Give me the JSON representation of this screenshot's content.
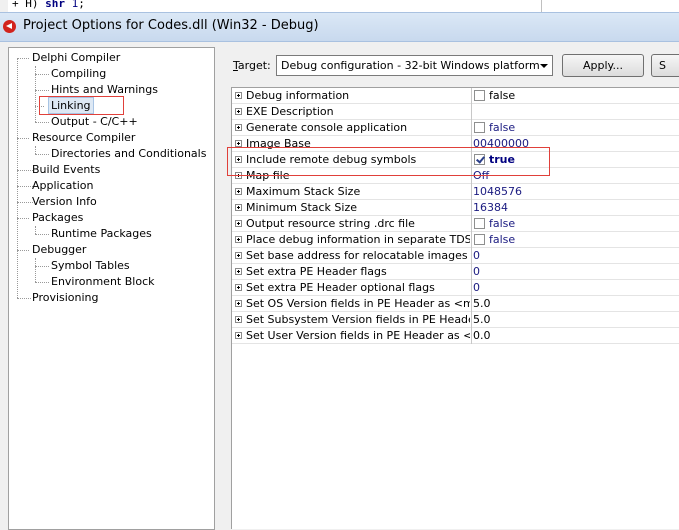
{
  "window": {
    "title": "Project Options for Codes.dll  (Win32 - Debug)"
  },
  "code_fragment": {
    "prefix": "+ H)  ",
    "keyword": "shr",
    "number": "1",
    "suffix": ";"
  },
  "tree": {
    "delphi_compiler": "Delphi Compiler",
    "compiling": "Compiling",
    "hints_warnings": "Hints and Warnings",
    "linking": "Linking",
    "output_c": "Output - C/C++",
    "resource_compiler": "Resource Compiler",
    "dirs_conditionals": "Directories and Conditionals",
    "build_events": "Build Events",
    "application": "Application",
    "version_info": "Version Info",
    "packages": "Packages",
    "runtime_packages": "Runtime Packages",
    "debugger": "Debugger",
    "symbol_tables": "Symbol Tables",
    "environment_block": "Environment Block",
    "provisioning": "Provisioning"
  },
  "target": {
    "label_prefix": "",
    "label_accel": "T",
    "label_rest": "arget:",
    "value": "Debug configuration - 32-bit Windows platform",
    "apply_label": "Apply...",
    "save_label": "S"
  },
  "properties": [
    {
      "name": "Debug information",
      "value": "false",
      "checkbox": true,
      "checked": false
    },
    {
      "name": "EXE Description",
      "value": "",
      "checkbox": false
    },
    {
      "name": "Generate console application",
      "value": "false",
      "checkbox": true,
      "checked": false
    },
    {
      "name": "Image Base",
      "value": "00400000",
      "checkbox": false
    },
    {
      "name": "Include remote debug symbols",
      "value": "true",
      "checkbox": true,
      "checked": true,
      "bold": true
    },
    {
      "name": "Map file",
      "value": "Off",
      "checkbox": false
    },
    {
      "name": "Maximum Stack Size",
      "value": "1048576",
      "checkbox": false
    },
    {
      "name": "Minimum Stack Size",
      "value": "16384",
      "checkbox": false
    },
    {
      "name": "Output resource string .drc file",
      "value": "false",
      "checkbox": true,
      "checked": false
    },
    {
      "name": "Place debug information in separate TDS file",
      "value": "false",
      "checkbox": true,
      "checked": false
    },
    {
      "name": "Set base address for relocatable images",
      "value": "0",
      "checkbox": false
    },
    {
      "name": "Set extra PE Header flags",
      "value": "0",
      "checkbox": false
    },
    {
      "name": "Set extra PE Header optional flags",
      "value": "0",
      "checkbox": false
    },
    {
      "name": "Set OS Version fields in PE Header as <major>",
      "value": "5.0",
      "checkbox": false,
      "plain": true
    },
    {
      "name": "Set Subsystem Version fields in PE Header as <major>",
      "value": "5.0",
      "checkbox": false,
      "plain": true
    },
    {
      "name": "Set User Version fields in PE Header as <major>",
      "value": "0.0",
      "checkbox": false,
      "plain": true
    }
  ]
}
